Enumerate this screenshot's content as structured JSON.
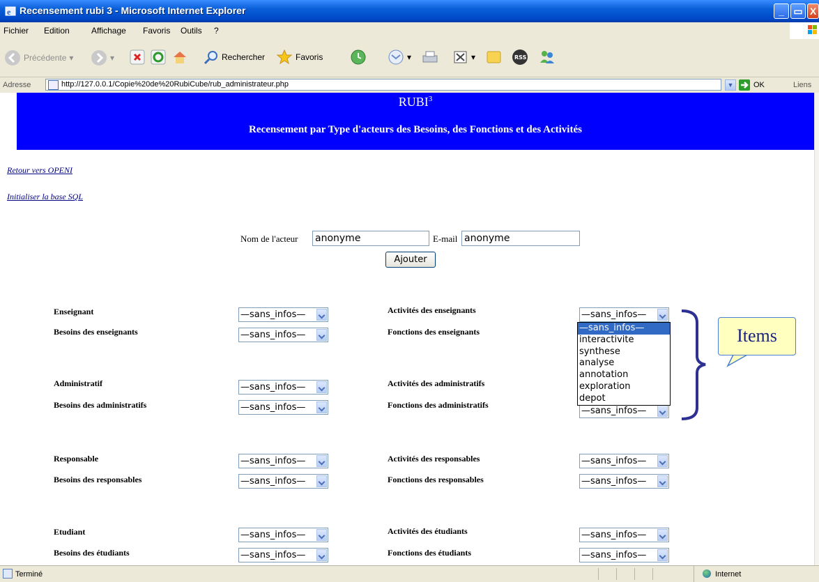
{
  "window": {
    "title": "Recensement rubi 3 - Microsoft Internet Explorer",
    "controls": [
      "_",
      "▭",
      "X"
    ]
  },
  "menu": {
    "items": [
      {
        "label": "Fichier"
      },
      {
        "label": "Edition"
      },
      {
        "label": "Affichage"
      },
      {
        "label": "Favoris"
      },
      {
        "label": "Outils"
      },
      {
        "label": "?"
      }
    ]
  },
  "toolbar": {
    "back_label": "Précédente",
    "search_label": "Rechercher",
    "favorites_label": "Favoris",
    "rss_label": "RSS"
  },
  "address": {
    "label": "Adresse",
    "url": "http://127.0.0.1/Copie%20de%20RubiCube/rub_administrateur.php",
    "go_label": "OK",
    "links_label": "Liens"
  },
  "banner": {
    "title": "RUBI",
    "title_sup": "3",
    "subtitle": "Recensement par Type d'acteurs des Besoins, des Fonctions et des Activités"
  },
  "links": {
    "back_to_openi": "Retour vers OPENI",
    "init_sql": "Initialiser la base SQL"
  },
  "form": {
    "actor_label": "Nom de l'acteur",
    "actor_value": "anonyme",
    "email_label": "E-mail",
    "email_value": "anonyme",
    "add_button": "Ajouter"
  },
  "groups": [
    {
      "actor": "Enseignant",
      "besoins": "Besoins des enseignants",
      "activites": "Activités des enseignants",
      "fonctions": "Fonctions des enseignants"
    },
    {
      "actor": "Administratif",
      "besoins": "Besoins des administratifs",
      "activites": "Activités des administratifs",
      "fonctions": "Fonctions des administratifs"
    },
    {
      "actor": "Responsable",
      "besoins": "Besoins des responsables",
      "activites": "Activités des responsables",
      "fonctions": "Fonctions des responsables"
    },
    {
      "actor": "Etudiant",
      "besoins": "Besoins des étudiants",
      "activites": "Activités des étudiants",
      "fonctions": "Fonctions des étudiants"
    }
  ],
  "select_default": "—sans_infos—",
  "open_dropdown": {
    "options": [
      "—sans_infos—",
      "interactivite",
      "synthese",
      "analyse",
      "annotation",
      "exploration",
      "depot"
    ],
    "selected_index": 0
  },
  "callout": {
    "text": "Items",
    "accent_color": "#2e3192"
  },
  "status": {
    "text": "Terminé",
    "zone": "Internet"
  },
  "colors": {
    "banner_bg": "#0000ff",
    "selected_option": "#316ac5"
  }
}
